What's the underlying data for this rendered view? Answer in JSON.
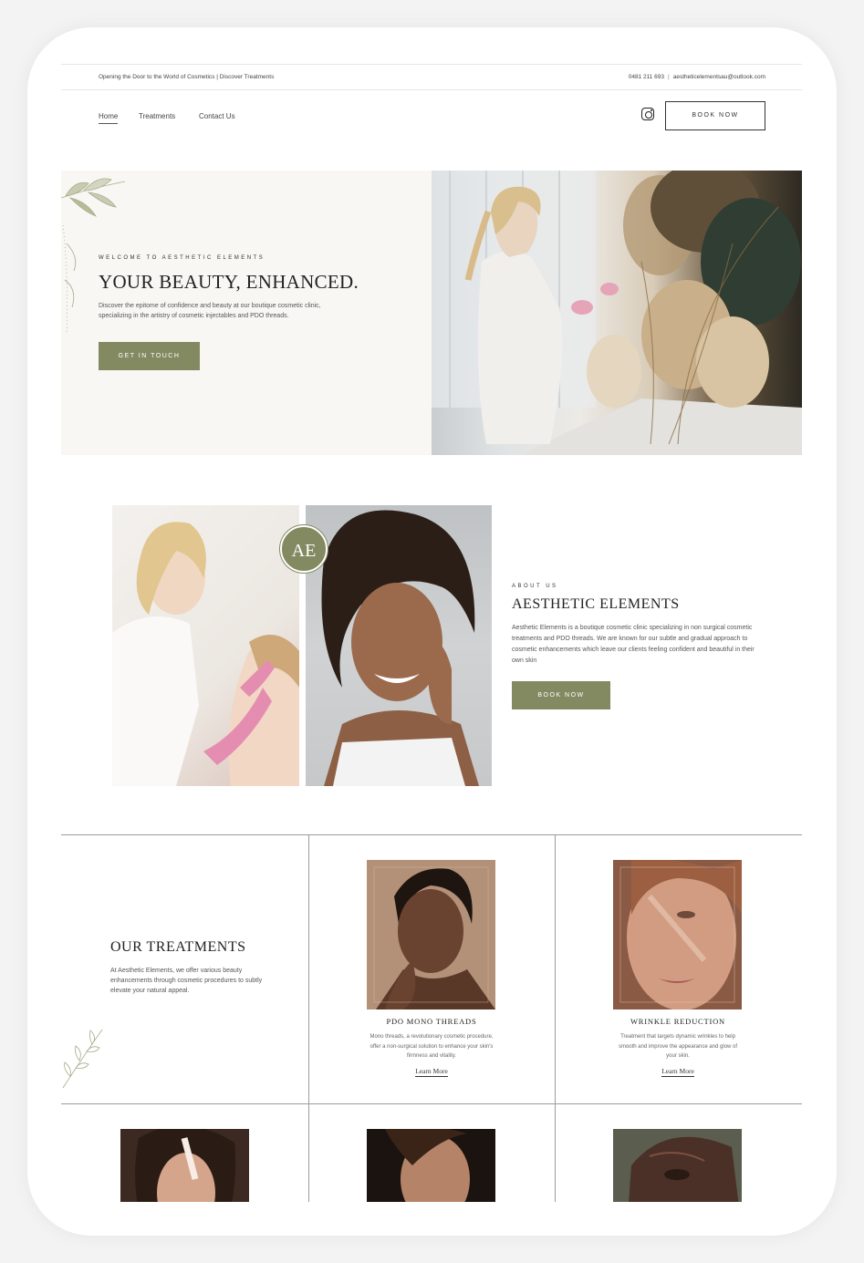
{
  "topbar": {
    "tagline": "Opening the Door to the World of Cosmetics | Discover Treatments",
    "phone": "0481 211 693",
    "separator": "|",
    "email": "aestheticelementsau@outlook.com"
  },
  "nav": {
    "items": [
      {
        "label": "Home",
        "active": true
      },
      {
        "label": "Treatments"
      },
      {
        "label": "Contact Us"
      }
    ],
    "book_label": "BOOK NOW",
    "social_icon": "instagram-icon"
  },
  "hero": {
    "kicker": "WELCOME TO AESTHETIC ELEMENTS",
    "title": "YOUR BEAUTY, ENHANCED.",
    "description": "Discover the epitome of confidence and beauty at our boutique cosmetic clinic, specializing in the artistry of cosmetic injectables and PDO threads.",
    "cta": "GET IN TOUCH"
  },
  "about": {
    "badge": "AE",
    "kicker": "ABOUT US",
    "title": "AESTHETIC ELEMENTS",
    "description": "Aesthetic Elements is a boutique cosmetic clinic specializing in non surgical cosmetic treatments and PDO threads. We are known for our subtle and gradual approach to cosmetic enhancements which leave our clients feeling confident and beautiful in their own skin",
    "cta": "BOOK NOW"
  },
  "treatments": {
    "title": "OUR TREATMENTS",
    "description": "At Aesthetic Elements, we offer various beauty enhancements through cosmetic procedures to subtly elevate your natural appeal.",
    "cards": [
      {
        "title": "PDO MONO THREADS",
        "description": "Mono threads, a revolutionary cosmetic procedure, offer a non-surgical solution to enhance your skin's firmness and vitality.",
        "link": "Learn More"
      },
      {
        "title": "WRINKLE REDUCTION",
        "description": "Treatment that targets dynamic wrinkles to help smooth and improve the appearance and glow of your skin.",
        "link": "Learn More"
      }
    ]
  },
  "colors": {
    "accent": "#838a62",
    "hero_bg": "#f8f7f4"
  }
}
